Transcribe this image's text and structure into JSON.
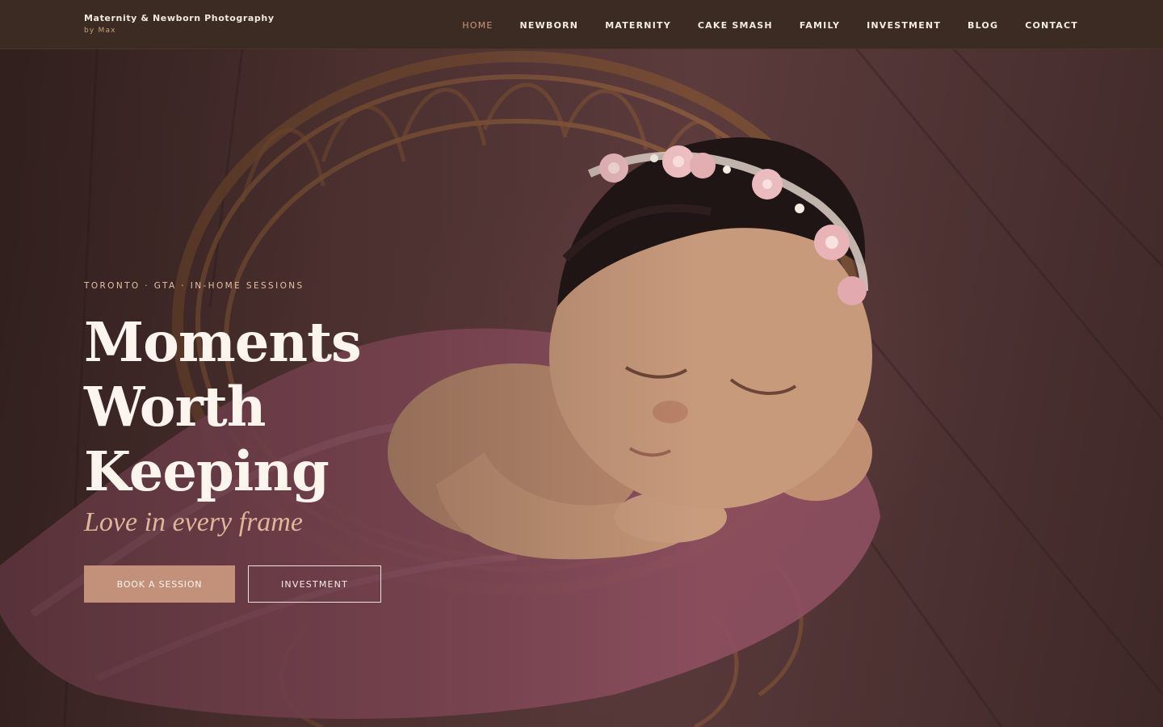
{
  "brand": {
    "name": "Maternity & Newborn Photography",
    "byline": "by Max"
  },
  "nav": {
    "items": [
      {
        "label": "HOME",
        "active": true
      },
      {
        "label": "NEWBORN",
        "active": false
      },
      {
        "label": "MATERNITY",
        "active": false
      },
      {
        "label": "CAKE SMASH",
        "active": false
      },
      {
        "label": "FAMILY",
        "active": false
      },
      {
        "label": "INVESTMENT",
        "active": false
      },
      {
        "label": "BLOG",
        "active": false
      },
      {
        "label": "CONTACT",
        "active": false
      }
    ]
  },
  "hero": {
    "eyebrow": "TORONTO · GTA · IN-HOME SESSIONS",
    "headline": [
      "Moments",
      "Worth",
      "Keeping"
    ],
    "tagline": "Love in every frame",
    "cta_primary": "BOOK A SESSION",
    "cta_secondary": "INVESTMENT"
  },
  "colors": {
    "nav_bg": "#3b2b22",
    "accent": "#c39179",
    "active_nav": "#c99a7c",
    "headline": "#fbf5ee",
    "tagline": "#dfb69a"
  }
}
